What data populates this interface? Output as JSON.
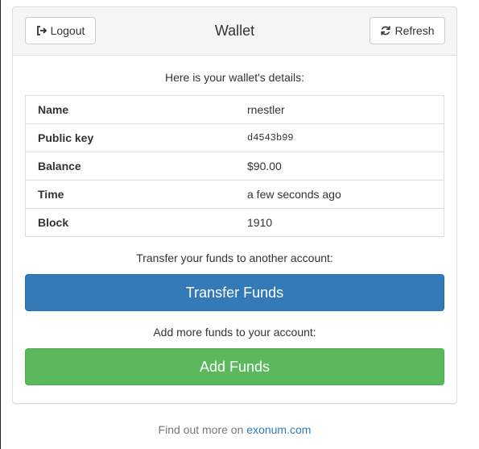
{
  "header": {
    "title": "Wallet",
    "logout_label": "Logout",
    "refresh_label": "Refresh"
  },
  "intro": "Here is your wallet's details:",
  "details": [
    {
      "label": "Name",
      "value": "rnestler"
    },
    {
      "label": "Public key",
      "value": "d4543b99"
    },
    {
      "label": "Balance",
      "value": "$90.00"
    },
    {
      "label": "Time",
      "value": "a few seconds ago"
    },
    {
      "label": "Block",
      "value": "1910"
    }
  ],
  "transfer": {
    "prompt": "Transfer your funds to another account:",
    "button_label": "Transfer Funds"
  },
  "add": {
    "prompt": "Add more funds to your account:",
    "button_label": "Add Funds"
  },
  "footer": {
    "text": "Find out more on",
    "link_label": "exonum.com"
  },
  "colors": {
    "primary": "#337ab7",
    "success": "#5cb85c",
    "heading_bg": "#f5f5f5",
    "border": "#dddddd"
  },
  "icons": {
    "logout": "sign-out-icon",
    "refresh": "refresh-icon"
  }
}
